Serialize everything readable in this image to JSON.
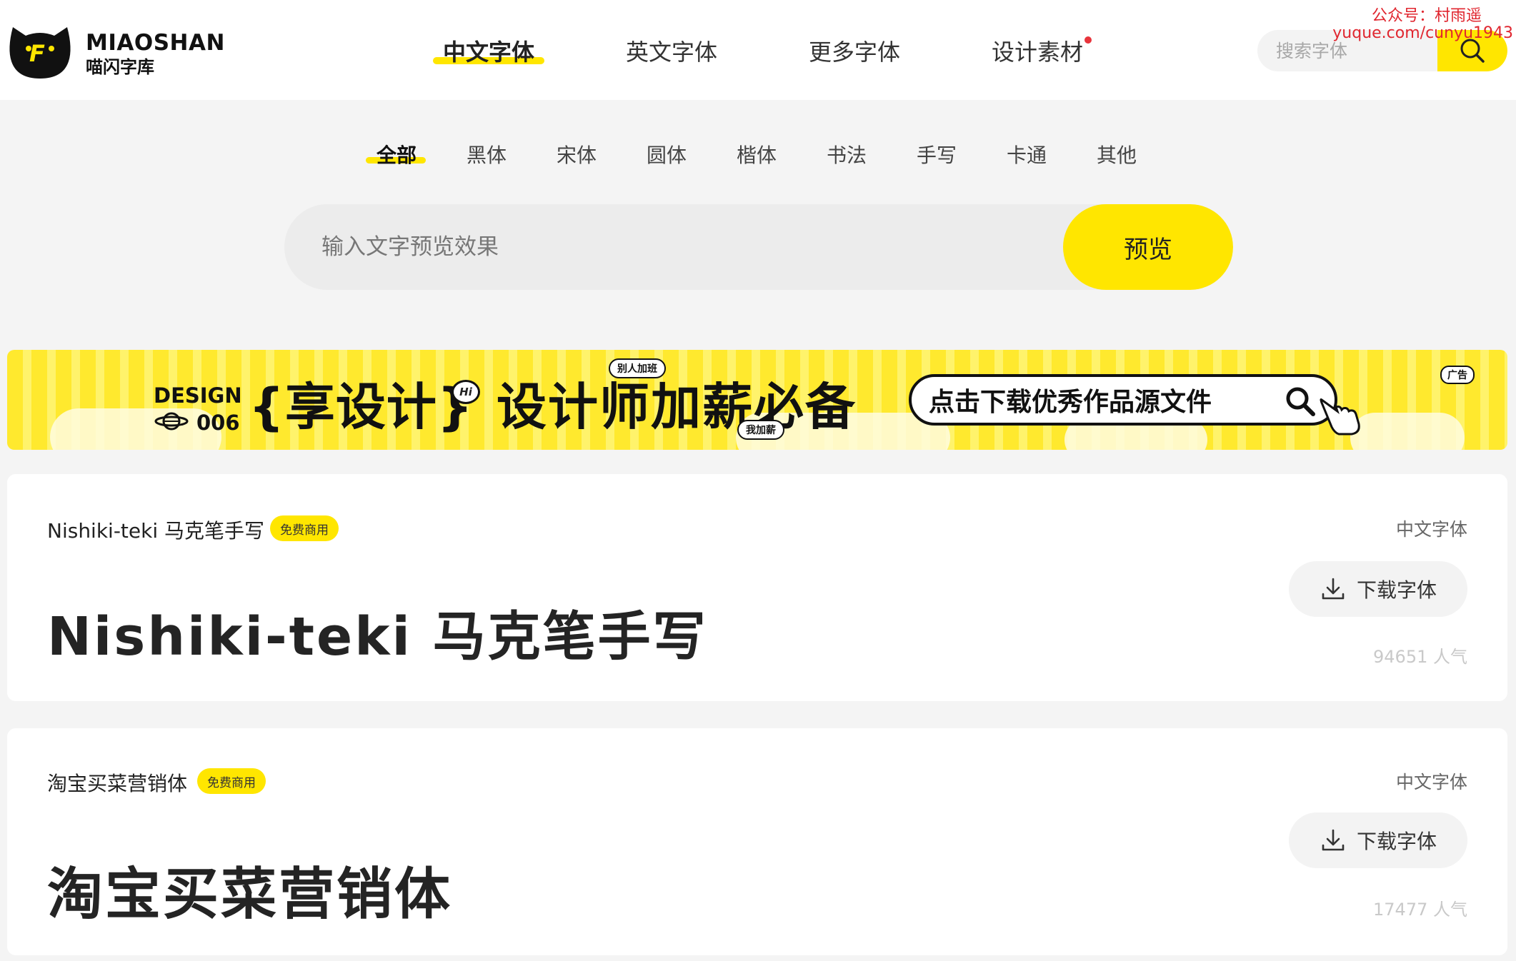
{
  "header": {
    "logo_en": "MIAOSHAN",
    "logo_cn": "喵闪字库",
    "logo_letter": "F",
    "nav": [
      {
        "label": "中文字体",
        "active": true
      },
      {
        "label": "英文字体",
        "active": false
      },
      {
        "label": "更多字体",
        "active": false
      },
      {
        "label": "设计素材",
        "active": false,
        "dot": true
      }
    ],
    "search_placeholder": "搜索字体",
    "search_icon": "search-icon"
  },
  "watermark": {
    "line1": "公众号：村雨遥",
    "line2": "yuque.com/cunyu1943"
  },
  "categories": [
    {
      "label": "全部",
      "active": true
    },
    {
      "label": "黑体"
    },
    {
      "label": "宋体"
    },
    {
      "label": "圆体"
    },
    {
      "label": "楷体"
    },
    {
      "label": "书法"
    },
    {
      "label": "手写"
    },
    {
      "label": "卡通"
    },
    {
      "label": "其他"
    }
  ],
  "preview": {
    "placeholder": "输入文字预览效果",
    "button": "预览"
  },
  "banner": {
    "design": "DESIGN",
    "number": "006",
    "share": "{享设计}",
    "hi": "Hi",
    "tag_top": "别人加班",
    "headline": "设计师加薪必备",
    "tag_bottom": "我加薪",
    "cta": "点击下载优秀作品源文件",
    "ad_label": "广告",
    "colors": {
      "primary": "#ffe92e",
      "stripe": "#fff36b"
    }
  },
  "fonts": [
    {
      "name": "Nishiki-teki 马克笔手写",
      "badge": "免费商用",
      "category": "中文字体",
      "download": "下载字体",
      "popularity": "94651 人气",
      "sample": "Nishiki-teki 马克笔手写"
    },
    {
      "name": "淘宝买菜营销体",
      "badge": "免费商用",
      "category": "中文字体",
      "download": "下载字体",
      "popularity": "17477 人气",
      "sample": "淘宝买菜营销体"
    }
  ],
  "colors": {
    "accent": "#ffe600",
    "dot": "#e8343c",
    "watermark": "#e0262f"
  }
}
